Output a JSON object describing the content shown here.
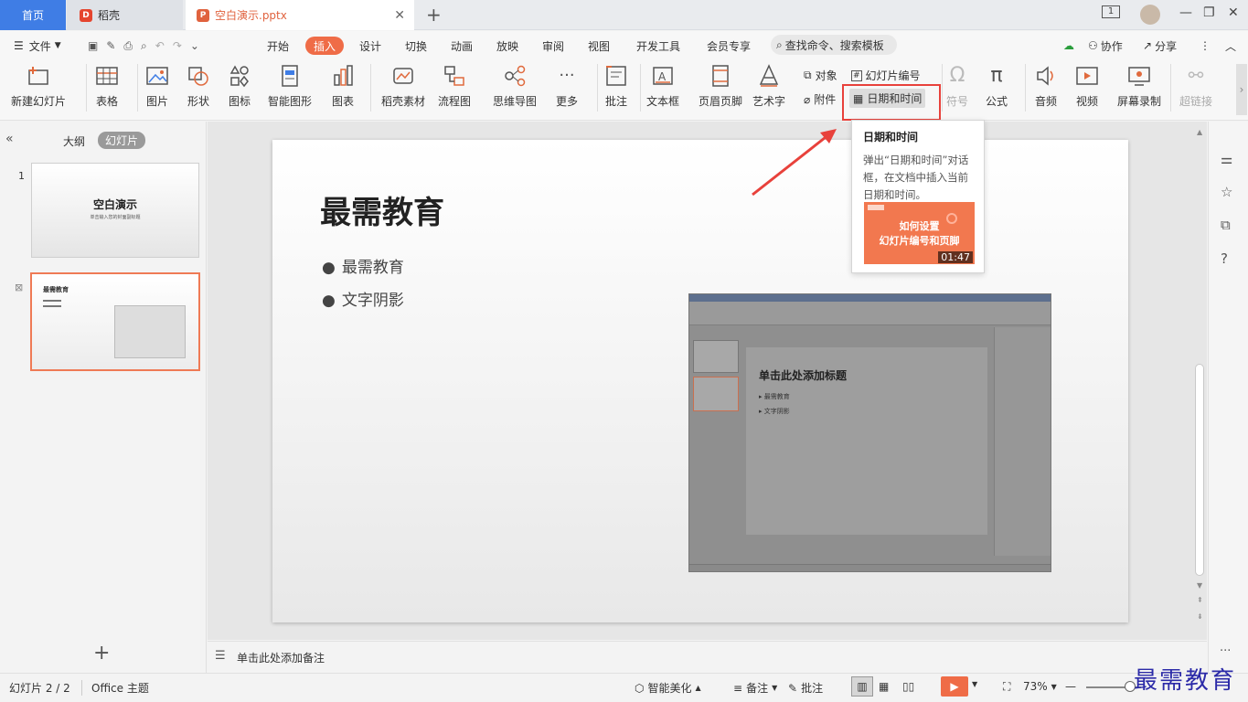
{
  "tabs": {
    "home": "首页",
    "daoke": "稻壳",
    "doc": "空白演示.pptx"
  },
  "menu": {
    "file": "文件",
    "tabs": [
      "开始",
      "插入",
      "设计",
      "切换",
      "动画",
      "放映",
      "审阅",
      "视图",
      "开发工具",
      "会员专享"
    ],
    "search": "查找命令、搜索模板",
    "cowork": "协作",
    "share": "分享"
  },
  "ribbon": {
    "new_slide": "新建幻灯片",
    "table": "表格",
    "picture": "图片",
    "shape": "形状",
    "icon": "图标",
    "smart": "智能图形",
    "chart": "图表",
    "daoke_material": "稻壳素材",
    "flow": "流程图",
    "mindmap": "思维导图",
    "more": "更多",
    "comment": "批注",
    "textbox": "文本框",
    "header_footer": "页眉页脚",
    "wordart": "艺术字",
    "object": "对象",
    "attachment": "附件",
    "slide_number": "幻灯片编号",
    "datetime": "日期和时间",
    "symbol": "符号",
    "formula": "公式",
    "audio": "音频",
    "video": "视频",
    "screen_rec": "屏幕录制",
    "hyperlink": "超链接"
  },
  "leftpanel": {
    "outline": "大纲",
    "slides": "幻灯片",
    "slide1_num": "1",
    "slide1_title": "空白演示",
    "slide1_sub": "单击输入您的封面副标题",
    "slide2_title": "最需教育"
  },
  "slide": {
    "title": "最需教育",
    "bullets": [
      "最需教育",
      "文字阴影"
    ],
    "inner_title": "单击此处添加标题",
    "inner_bullets": [
      "最需教育",
      "文字阴影"
    ]
  },
  "tooltip": {
    "title": "日期和时间",
    "desc": "弹出“日期和时间”对话框，在文档中插入当前日期和时间。",
    "video_title1": "如何设置",
    "video_title2": "幻灯片编号和页脚",
    "duration": "01:47"
  },
  "notes": {
    "placeholder": "单击此处添加备注"
  },
  "status": {
    "slide_info": "幻灯片 2 / 2",
    "theme": "Office 主题",
    "beautify": "智能美化",
    "notes": "备注",
    "comment": "批注",
    "zoom": "73%"
  },
  "watermark": "最需教育",
  "colors": {
    "accent": "#ef6c47",
    "home_tab": "#3f7de5",
    "highlight_box": "#e8413b",
    "arrow": "#e8413b"
  }
}
